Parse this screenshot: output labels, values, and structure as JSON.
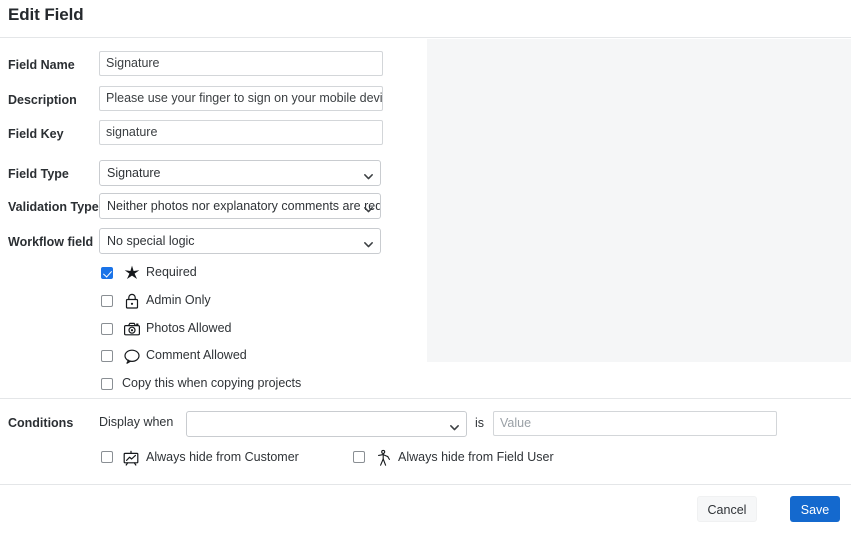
{
  "header": {
    "title": "Edit Field"
  },
  "form": {
    "fields": [
      {
        "label": "Field Name",
        "type": "text",
        "value": "Signature"
      },
      {
        "label": "Description",
        "type": "text",
        "value": "Please use your finger to sign on your mobile device"
      },
      {
        "label": "Field Key",
        "type": "text",
        "value": "signature"
      },
      {
        "label": "Field Type",
        "type": "select",
        "value": "Signature"
      },
      {
        "label": "Validation Type",
        "type": "select",
        "value": "Neither photos nor explanatory comments are required"
      },
      {
        "label": "Workflow field",
        "type": "select",
        "value": "No special logic"
      }
    ],
    "checkboxes": [
      {
        "label": "Required",
        "checked": true,
        "icon": "star-icon"
      },
      {
        "label": "Admin Only",
        "checked": false,
        "icon": "lock-icon"
      },
      {
        "label": "Photos Allowed",
        "checked": false,
        "icon": "camera-icon"
      },
      {
        "label": "Comment Allowed",
        "checked": false,
        "icon": "comment-icon"
      },
      {
        "label": "Copy this when copying projects",
        "checked": false,
        "icon": null
      }
    ]
  },
  "conditions": {
    "label": "Conditions",
    "display_when_label": "Display when",
    "display_when_value": "",
    "is_label": "is",
    "value_placeholder": "Value",
    "value": "",
    "hide_options": [
      {
        "label": "Always hide from Customer",
        "checked": false,
        "icon": "presentation-chart-icon"
      },
      {
        "label": "Always hide from Field User",
        "checked": false,
        "icon": "worker-icon"
      }
    ]
  },
  "footer": {
    "cancel_label": "Cancel",
    "save_label": "Save"
  },
  "colors": {
    "accent": "#1a73e8",
    "save_button": "#1469ce",
    "panel_bg": "#f5f6f7",
    "border": "#e4e6e8"
  }
}
